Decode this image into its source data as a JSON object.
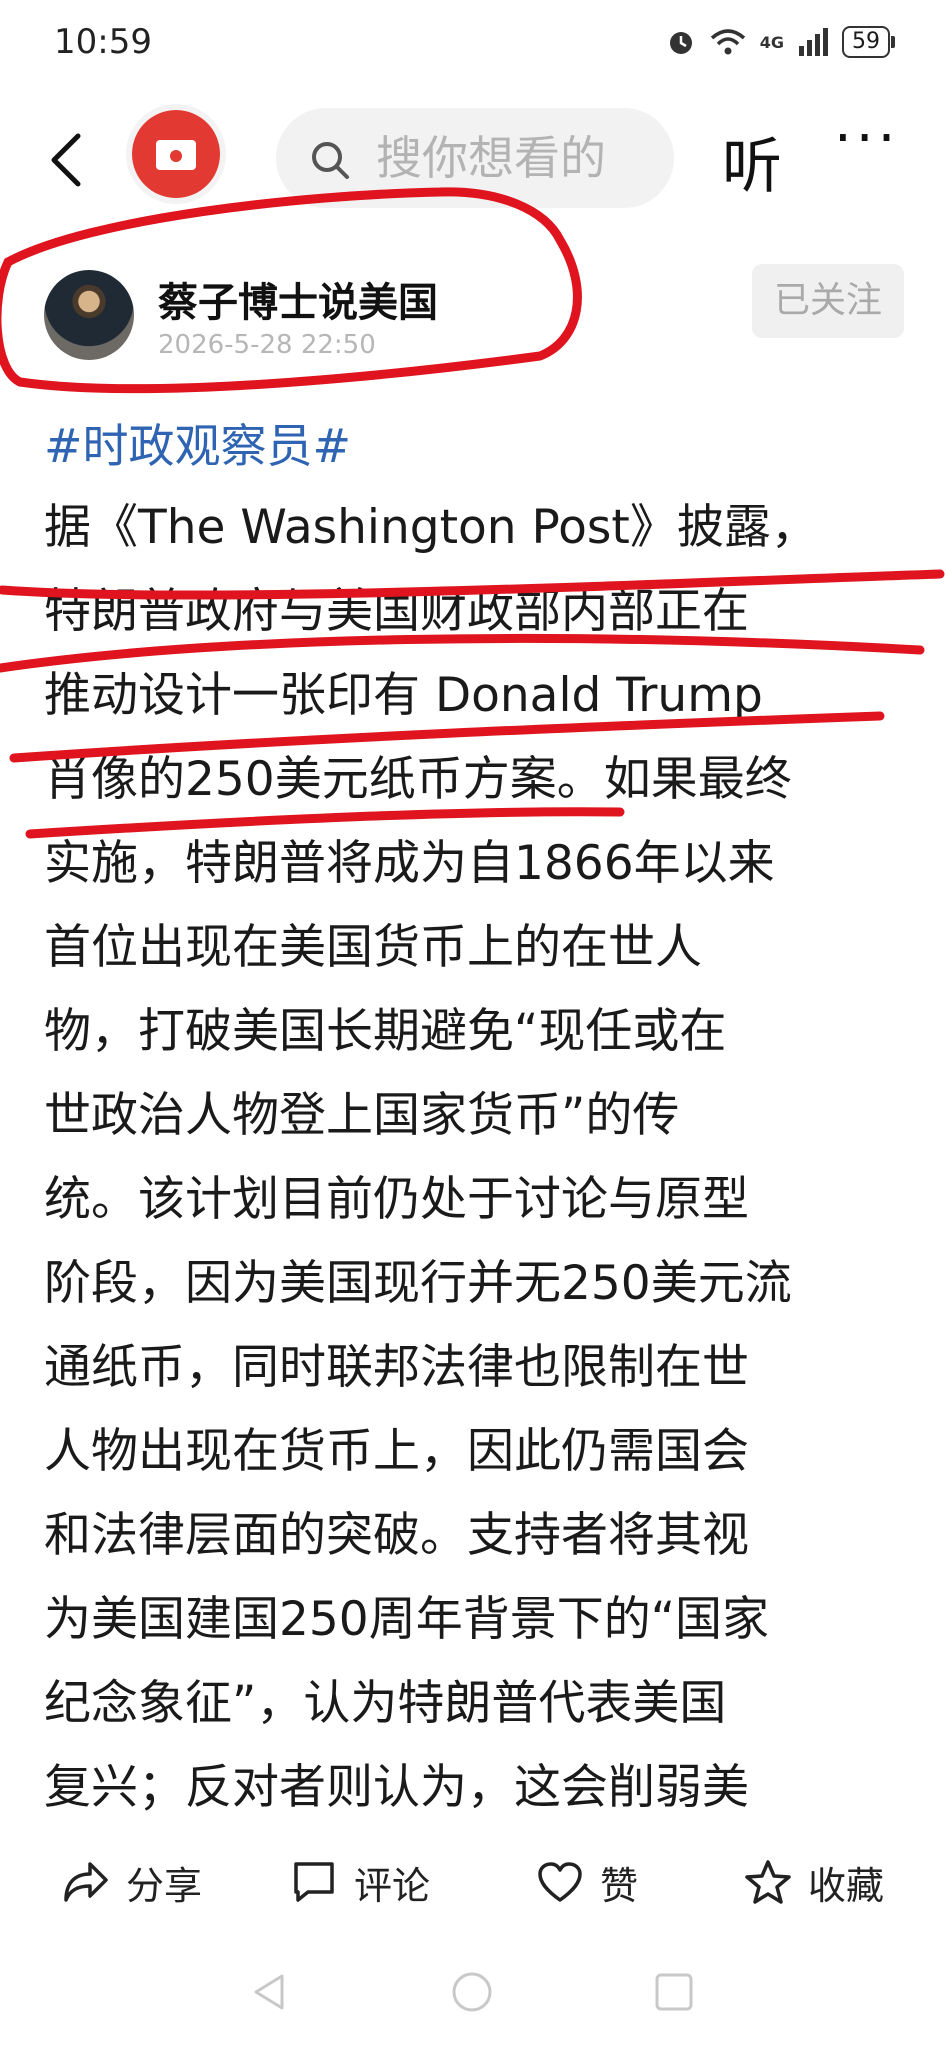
{
  "status_bar": {
    "time": "10:59",
    "network": "4G",
    "battery": "59"
  },
  "top_nav": {
    "search_placeholder": "搜你想看的",
    "listen_label": "听",
    "more_label": "···"
  },
  "author": {
    "name": "蔡子博士说美国",
    "time": "2026-5-28 22:50",
    "follow_label": "已关注"
  },
  "article": {
    "topic": "#时政观察员#",
    "lines": [
      "据《The Washington Post》披露，",
      "特朗普政府与美国财政部内部正在",
      "推动设计一张印有 Donald Trump",
      "肖像的250美元纸币方案。如果最终",
      "实施，特朗普将成为自1866年以来",
      "首位出现在美国货币上的在世人",
      "物，打破美国长期避免“现任或在",
      "世政治人物登上国家货币”的传",
      "统。该计划目前仍处于讨论与原型",
      "阶段，因为美国现行并无250美元流",
      "通纸币，同时联邦法律也限制在世",
      "人物出现在货币上，因此仍需国会",
      "和法律层面的突破。支持者将其视",
      "为美国建国250周年背景下的“国家",
      "纪念象征”，认为特朗普代表美国",
      "复兴；反对者则认为，这会削弱美"
    ]
  },
  "actions": {
    "share": "分享",
    "comment": "评论",
    "like": "赞",
    "collect": "收藏"
  },
  "colors": {
    "topic": "#2f64b3",
    "annotation": "#e0141e",
    "logo": "#e23a33"
  }
}
